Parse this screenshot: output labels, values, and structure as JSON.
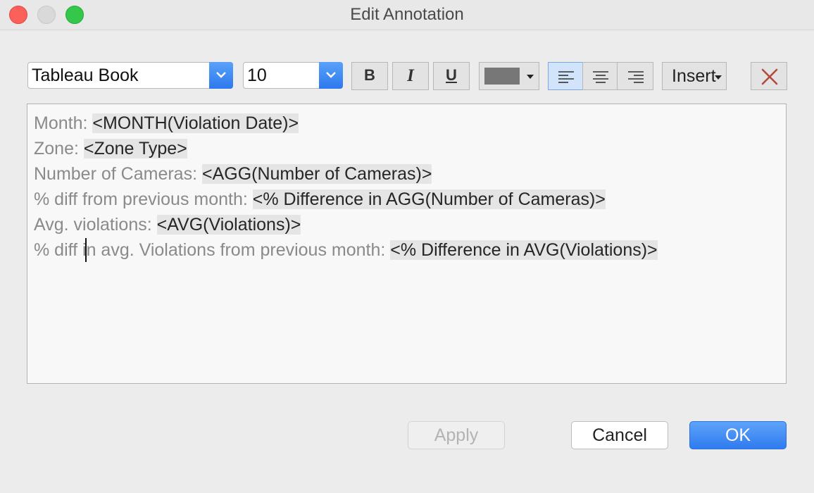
{
  "window": {
    "title": "Edit Annotation"
  },
  "toolbar": {
    "font": {
      "value": "Tableau Book"
    },
    "size": {
      "value": "10"
    },
    "bold_label": "B",
    "italic_label": "I",
    "underline_label": "U",
    "color": {
      "value": "#777777",
      "icon": "chevron-down-icon"
    },
    "align_selected": "left",
    "insert_label": "Insert",
    "clear_icon": "close-icon",
    "clear_color": "#b5493c"
  },
  "editor": {
    "lines": [
      {
        "label": "Month: ",
        "field": "<MONTH(Violation Date)>"
      },
      {
        "label": "Zone: ",
        "field": "<Zone Type>"
      },
      {
        "label": "Number of Cameras: ",
        "field": "<AGG(Number of Cameras)>"
      },
      {
        "label": "% diff from previous month: ",
        "field": "<% Difference in AGG(Number of Cameras)>"
      },
      {
        "label": "Avg. violations: ",
        "field": "<AVG(Violations)>"
      },
      {
        "label": "% diff in avg. Violations from previous month: ",
        "field": "<% Difference in AVG(Violations)>"
      }
    ]
  },
  "footer": {
    "apply_label": "Apply",
    "cancel_label": "Cancel",
    "ok_label": "OK",
    "accent": "#2f7bef"
  }
}
